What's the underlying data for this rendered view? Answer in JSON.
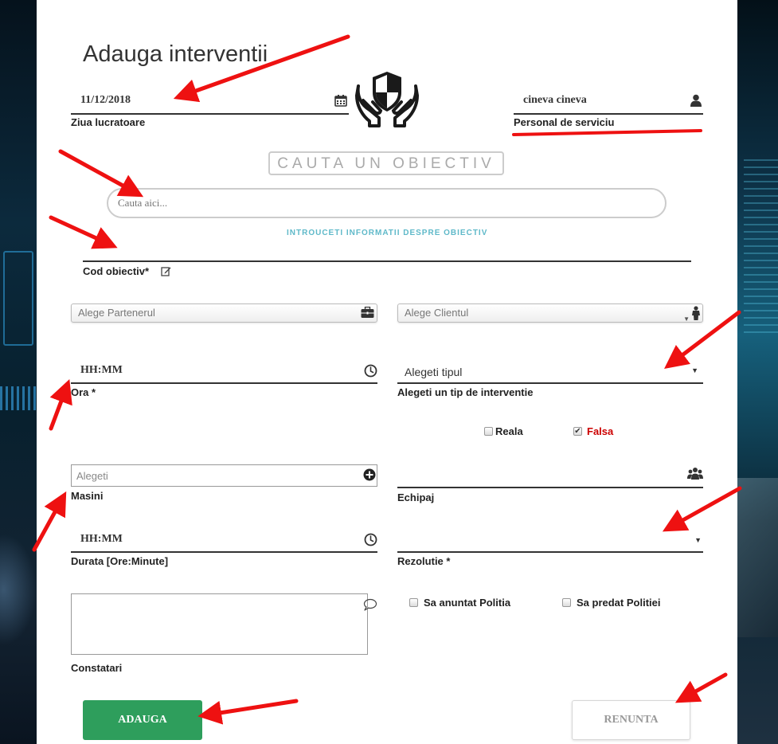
{
  "page": {
    "title": "Adauga interventii"
  },
  "date_field": {
    "value": "11/12/2018",
    "label": "Ziua lucratoare",
    "icon": "calendar-icon"
  },
  "logo": {
    "icon": "shield-hands-icon"
  },
  "personal_field": {
    "value": "cineva cineva",
    "label": "Personal de serviciu",
    "icon": "user-icon"
  },
  "objective_search": {
    "heading": "CAUTA UN OBIECTIV",
    "placeholder": "Cauta aici...",
    "info_link": "INTROUCETI INFORMATII DESPRE OBIECTIV"
  },
  "cod_objectiv": {
    "label": "Cod obiectiv*",
    "icon": "edit-icon"
  },
  "partener_select": {
    "placeholder": "Alege Partenerul",
    "icon": "briefcase-icon"
  },
  "client_select": {
    "placeholder": "Alege Clientul",
    "icon": "person-icon"
  },
  "ora_field": {
    "value": "HH:MM",
    "label": "Ora *",
    "icon": "clock-icon"
  },
  "tip_select": {
    "value": "Alegeti tipul",
    "label": "Alegeti un tip de interventie"
  },
  "tip_options": [
    {
      "label": "Reala",
      "checked": false,
      "color": "#222222"
    },
    {
      "label": "Falsa",
      "checked": true,
      "color": "#cc0000"
    }
  ],
  "masini_field": {
    "placeholder": "Alegeti",
    "label": "Masini",
    "icon": "plus-circle-icon"
  },
  "echipaj_field": {
    "label": "Echipaj",
    "icon": "group-icon"
  },
  "durata_field": {
    "value": "HH:MM",
    "label": "Durata [Ore:Minute]",
    "icon": "clock-icon"
  },
  "rezolutie_field": {
    "value": "",
    "label": "Rezolutie *"
  },
  "constatari": {
    "label": "Constatari",
    "icon": "comment-icon"
  },
  "politia": [
    {
      "label": "Sa anuntat Politia",
      "checked": false
    },
    {
      "label": "Sa predat Politiei",
      "checked": false
    }
  ],
  "buttons": {
    "add": "ADAUGA",
    "cancel": "RENUNTA"
  },
  "colors": {
    "accent_green": "#2e9e5c",
    "annotation_red": "#ee1111",
    "link_teal": "#5fb9c9"
  }
}
